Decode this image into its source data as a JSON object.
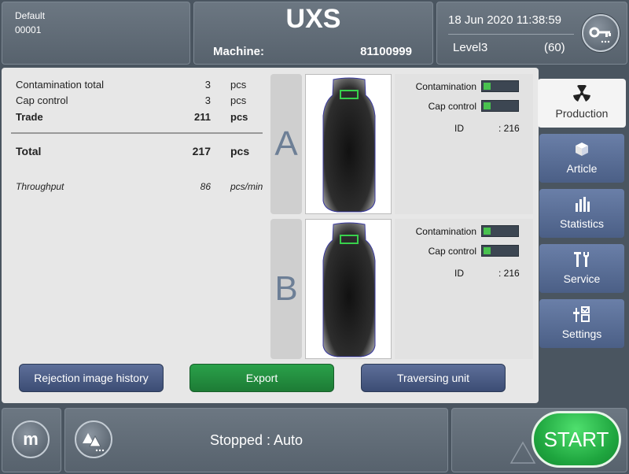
{
  "header": {
    "profile": "Default",
    "profile_no": "00001",
    "app_title": "UXS",
    "machine_label": "Machine:",
    "machine_no": "81100999",
    "datetime": "18 Jun 2020 11:38:59",
    "user_level": "Level3",
    "user_level_no": "(60)",
    "key_icon": "key-icon"
  },
  "stats": {
    "contamination_total": {
      "label": "Contamination total",
      "value": "3",
      "unit": "pcs"
    },
    "cap_control": {
      "label": "Cap control",
      "value": "3",
      "unit": "pcs"
    },
    "trade": {
      "label": "Trade",
      "value": "211",
      "unit": "pcs"
    },
    "total": {
      "label": "Total",
      "value": "217",
      "unit": "pcs"
    },
    "throughput": {
      "label": "Throughput",
      "value": "86",
      "unit": "pcs/min"
    }
  },
  "lanes": [
    {
      "name": "A",
      "contamination_label": "Contamination",
      "cap_control_label": "Cap control",
      "id_label": "ID",
      "id_value": ": 216"
    },
    {
      "name": "B",
      "contamination_label": "Contamination",
      "cap_control_label": "Cap control",
      "id_label": "ID",
      "id_value": ": 216"
    }
  ],
  "actions": {
    "rejection_history": "Rejection image history",
    "export": "Export",
    "traversing_unit": "Traversing unit"
  },
  "nav": [
    {
      "label": "Production",
      "icon": "radiation-icon",
      "active": true
    },
    {
      "label": "Article",
      "icon": "box-icon"
    },
    {
      "label": "Statistics",
      "icon": "bar-chart-icon"
    },
    {
      "label": "Service",
      "icon": "tools-icon"
    },
    {
      "label": "Settings",
      "icon": "settings-icon"
    }
  ],
  "footer": {
    "menu_button": "m",
    "status": "Stopped : Auto",
    "start_button": "START",
    "warning_icon": "warning-icon"
  },
  "colors": {
    "indicator_ok": "#49c24f",
    "export_button": "#2aa14a",
    "start_button": "#1fa63f",
    "nav_button": "#5a6e96"
  }
}
